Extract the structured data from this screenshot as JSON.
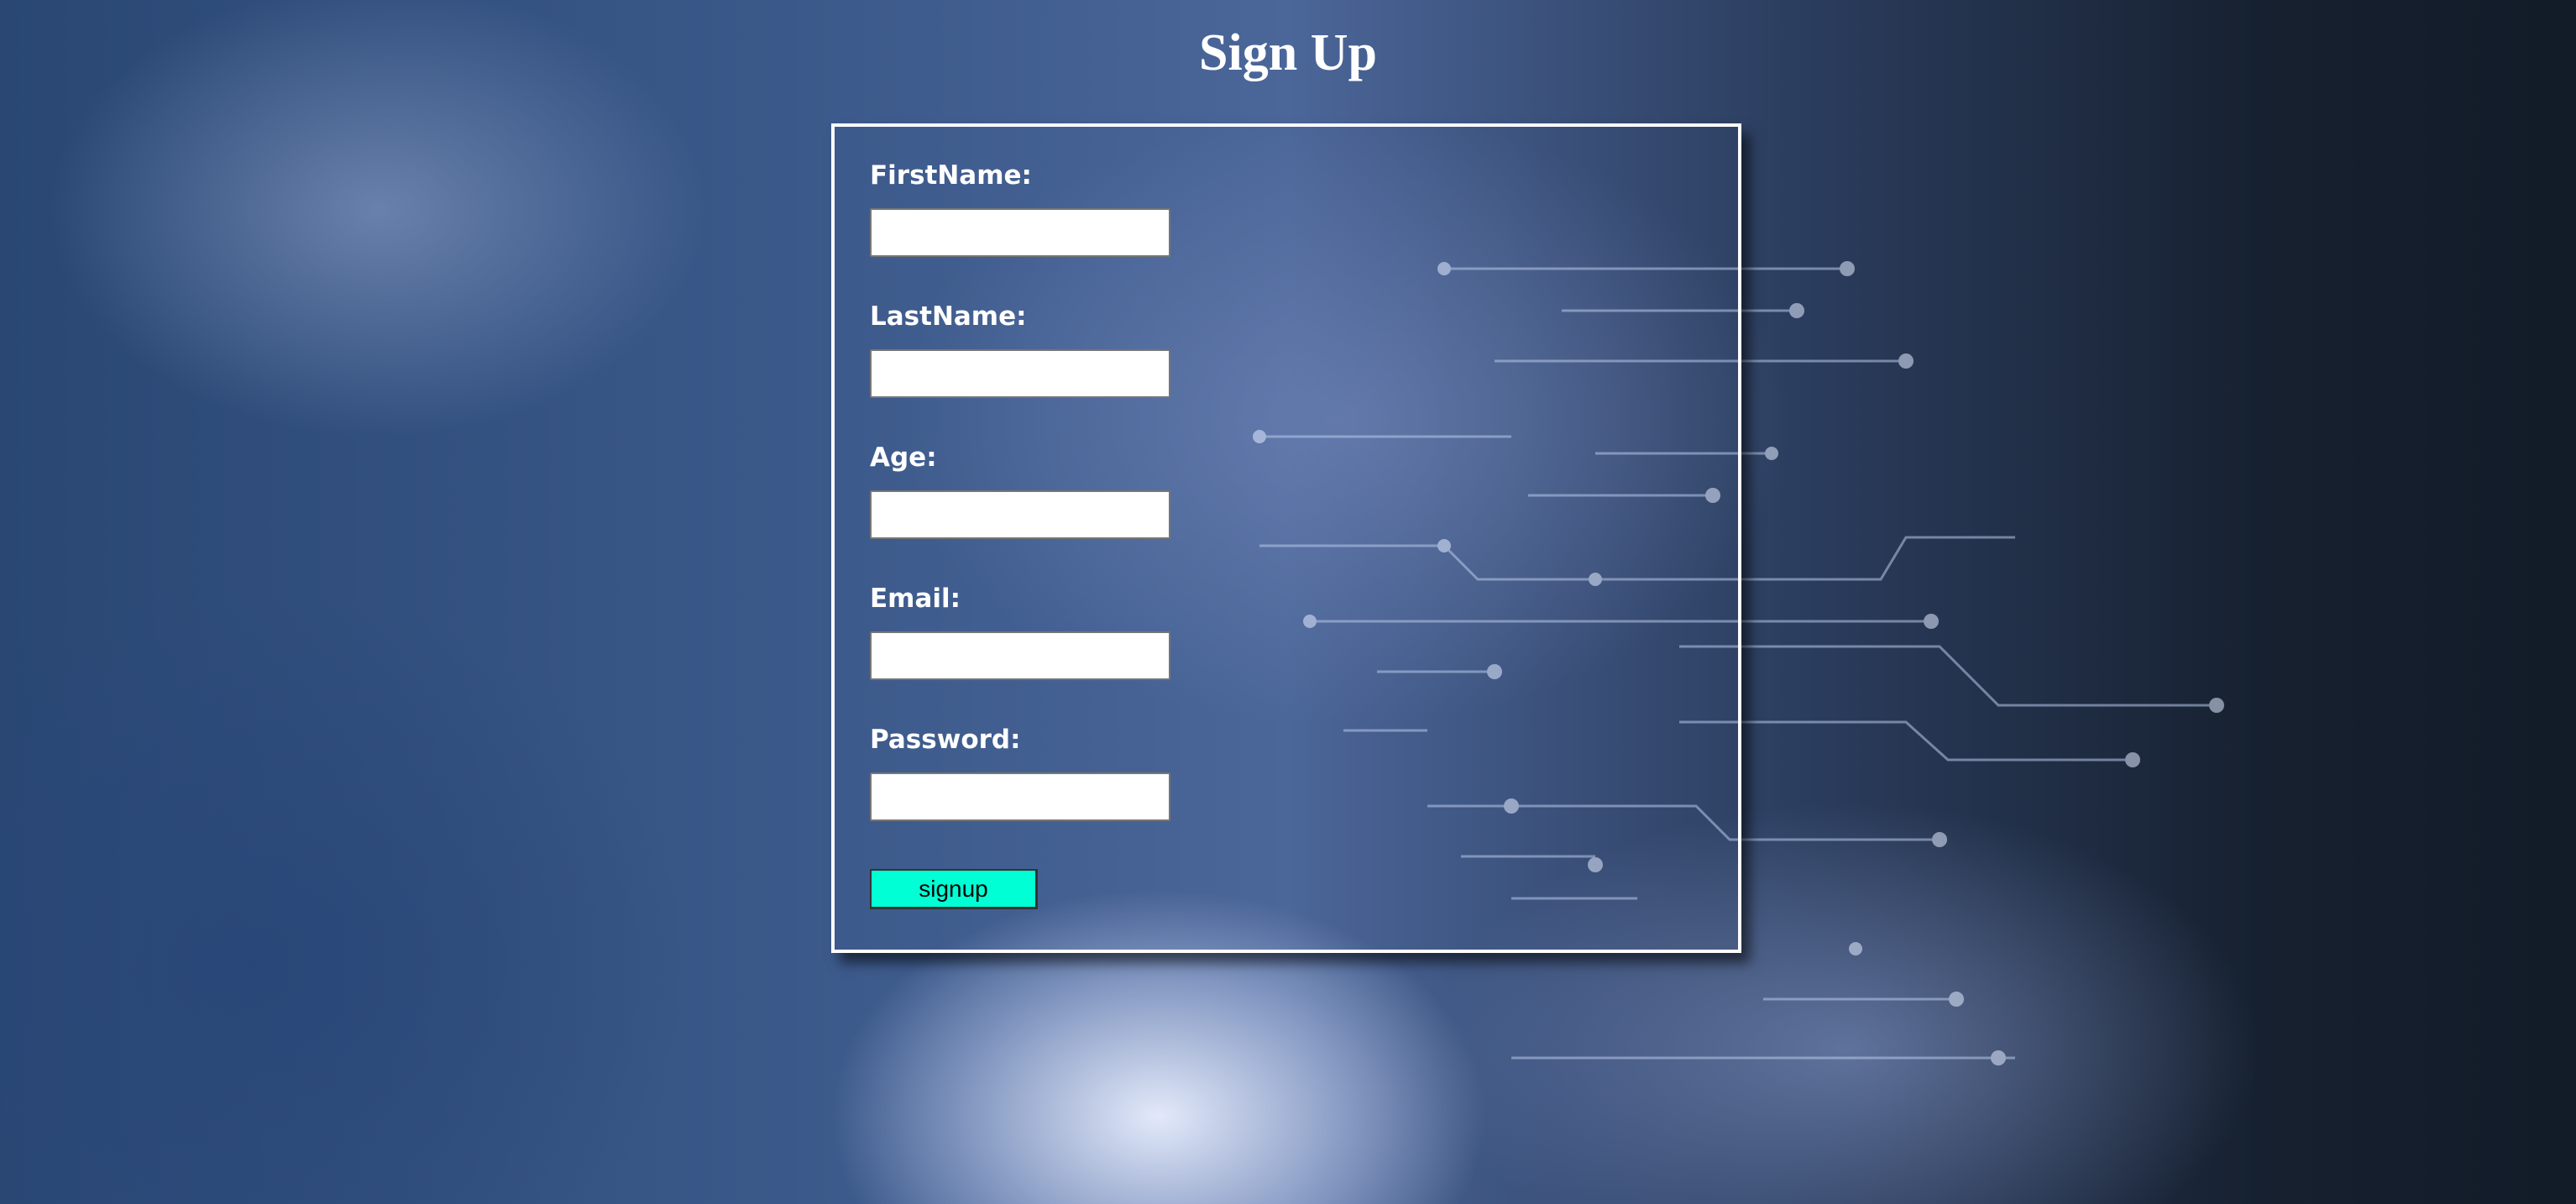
{
  "page": {
    "title": "Sign Up"
  },
  "form": {
    "fields": [
      {
        "label": "FirstName:",
        "value": ""
      },
      {
        "label": "LastName:",
        "value": ""
      },
      {
        "label": "Age:",
        "value": ""
      },
      {
        "label": "Email:",
        "value": ""
      },
      {
        "label": "Password:",
        "value": ""
      }
    ],
    "submit_label": "signup"
  },
  "colors": {
    "button_bg": "#00ffd5",
    "panel_border": "#ffffff",
    "text": "#ffffff"
  }
}
